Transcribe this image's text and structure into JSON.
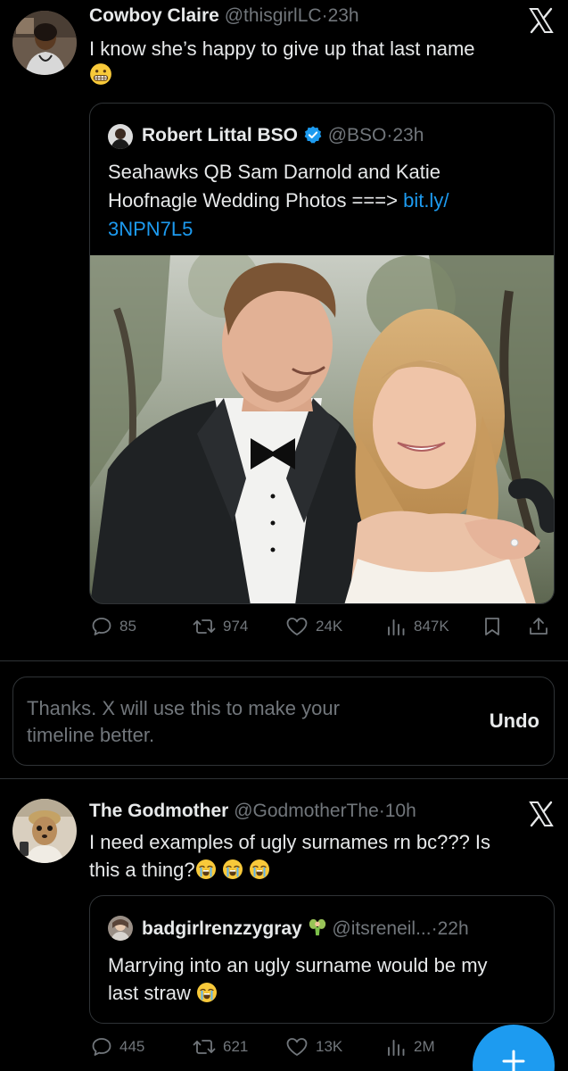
{
  "tweet1": {
    "name": "Cowboy Claire",
    "handle": "@thisgirlLC",
    "time": "23h",
    "text": "I know she’s happy to give up that last name",
    "emoji": "grimacing-face",
    "quote": {
      "name": "Robert Littal BSO",
      "verified": true,
      "handle": "@BSO",
      "time": "23h",
      "text": "Seahawks QB Sam Darnold and Katie Hoofnagle Wedding Photos ===>",
      "link_part1": "bit.ly/",
      "link_part2": "3NPN7L5"
    },
    "actions": {
      "replies": "85",
      "reposts": "974",
      "likes": "24K",
      "views": "847K"
    }
  },
  "notice": {
    "text": "Thanks. X will use this to make your timeline better.",
    "undo": "Undo"
  },
  "tweet2": {
    "name": "The Godmother",
    "handle": "@GodmotherThe",
    "time": "10h",
    "text_line1": "I need examples of ugly surnames rn bc??? Is",
    "text_line2": "this a thing?",
    "emoji": "loudly-crying-face",
    "quote": {
      "name": "badgirlrenzzygray",
      "handle": "@itsreneil...",
      "time": "22h",
      "text_line1": "Marrying into an ugly surname would be my",
      "text_line2": "last straw",
      "emoji": "loudly-crying-face"
    },
    "actions": {
      "replies": "445",
      "reposts": "621",
      "likes": "13K",
      "views": "2M"
    }
  },
  "colors": {
    "accent": "#1d9bf0",
    "background": "#000000",
    "muted": "#71767b",
    "border": "#2f3336"
  },
  "icons": [
    "x-logo-icon",
    "verified-badge-icon",
    "reply-icon",
    "repost-icon",
    "like-icon",
    "views-icon",
    "bookmark-icon",
    "share-icon",
    "plus-icon"
  ]
}
